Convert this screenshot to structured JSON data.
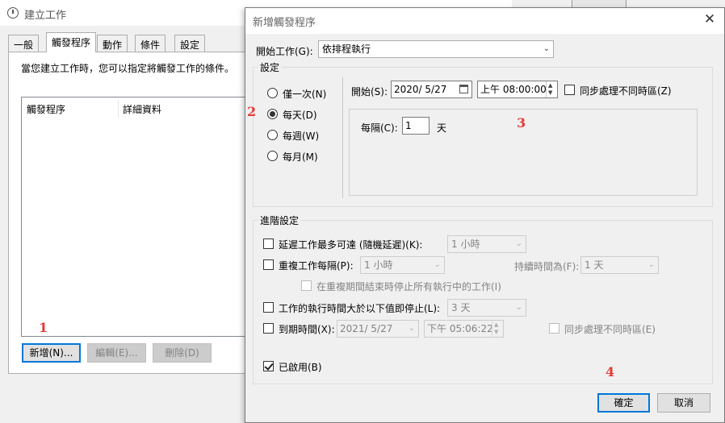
{
  "background_window": {
    "title": "建立工作",
    "tabs": [
      {
        "label": "一般"
      },
      {
        "label": "觸發程序"
      },
      {
        "label": "動作"
      },
      {
        "label": "條件"
      },
      {
        "label": "設定"
      }
    ],
    "hint": "當您建立工作時，您可以指定將觸發工作的條件。",
    "columns": [
      "觸發程序",
      "詳細資料"
    ],
    "buttons": {
      "new": "新增(N)...",
      "edit": "編輯(E)...",
      "delete": "刪除(D)"
    }
  },
  "dialog": {
    "title": "新增觸發程序",
    "close_glyph": "✕",
    "begin_task_label": "開始工作(G):",
    "begin_task_value": "依排程執行",
    "settings_label": "設定",
    "schedule_options": [
      "僅一次(N)",
      "每天(D)",
      "每週(W)",
      "每月(M)"
    ],
    "selected_schedule": "每天(D)",
    "start_label": "開始(S):",
    "start_date": "2020/  5/27",
    "start_time": "上午 08:00:00",
    "sync_timezone_label": "同步處理不同時區(Z)",
    "recur_label": "每隔(C):",
    "recur_value": "1",
    "recur_unit": "天",
    "advanced_label": "進階設定",
    "delay_label": "延遲工作最多可達 (隨機延遲)(K):",
    "delay_value": "1 小時",
    "repeat_label": "重複工作每隔(P):",
    "repeat_value": "1 小時",
    "duration_label": "持續時間為(F):",
    "duration_value": "1 天",
    "stop_running_label": "在重複期間結束時停止所有執行中的工作(I)",
    "stop_if_longer_label": "工作的執行時間大於以下值即停止(L):",
    "stop_if_longer_value": "3 天",
    "expire_label": "到期時間(X):",
    "expire_date": "2021/  5/27",
    "expire_time": "下午 05:06:22",
    "expire_sync_label": "同步處理不同時區(E)",
    "enabled_label": "已啟用(B)",
    "ok_label": "確定",
    "cancel_label": "取消"
  },
  "markers": [
    "1",
    "2",
    "3",
    "4"
  ],
  "colors": {
    "marker": "#e53935",
    "focus_border": "#0078d7",
    "window_bg": "#f0f0f0"
  }
}
